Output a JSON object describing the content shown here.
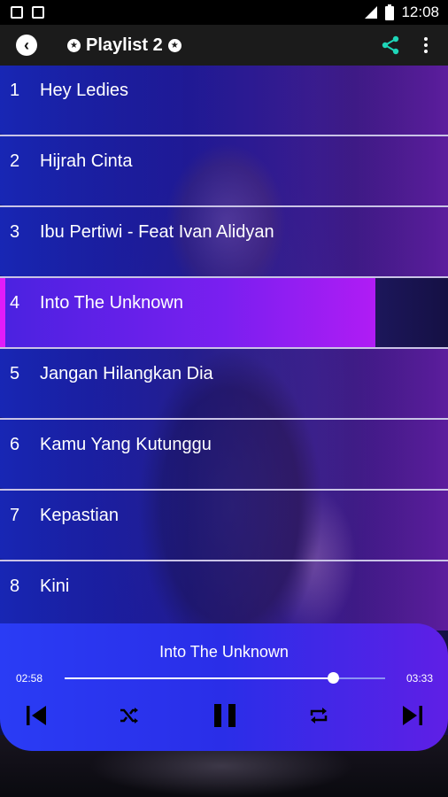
{
  "status": {
    "time": "12:08"
  },
  "appbar": {
    "title": "Playlist 2"
  },
  "playlist": [
    {
      "num": "1",
      "title": "Hey Ledies"
    },
    {
      "num": "2",
      "title": "Hijrah Cinta"
    },
    {
      "num": "3",
      "title": "Ibu Pertiwi - Feat Ivan Alidyan"
    },
    {
      "num": "4",
      "title": "Into The Unknown",
      "active": true
    },
    {
      "num": "5",
      "title": "Jangan Hilangkan Dia"
    },
    {
      "num": "6",
      "title": "Kamu Yang Kutunggu"
    },
    {
      "num": "7",
      "title": "Kepastian"
    },
    {
      "num": "8",
      "title": "Kini"
    }
  ],
  "player": {
    "now_playing": "Into The Unknown",
    "elapsed": "02:58",
    "duration": "03:33",
    "progress": 0.836
  },
  "colors": {
    "accent_share": "#1ed6b8",
    "active_row": "#7a1ff0",
    "player_bg": "#2a3cf5"
  }
}
